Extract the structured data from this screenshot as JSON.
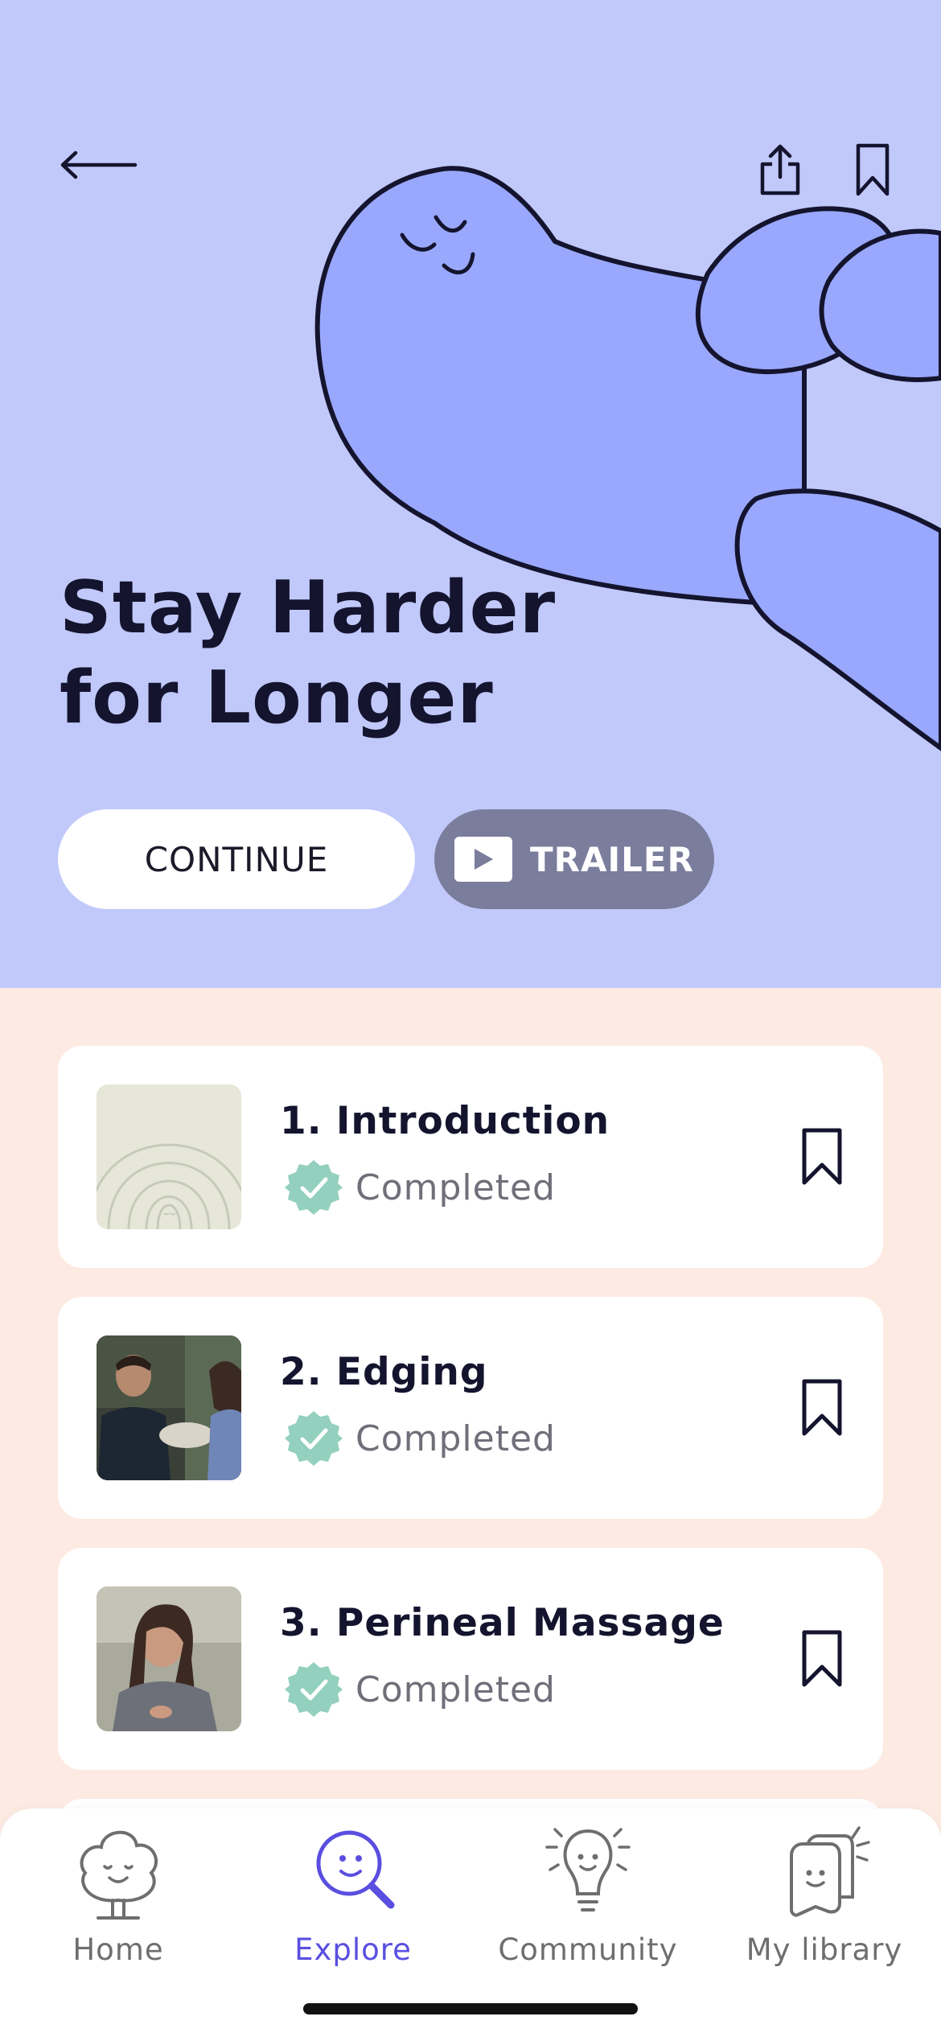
{
  "hero": {
    "title_line1": "Stay Harder",
    "title_line2": "for Longer",
    "background_color": "#c1c9fb",
    "continue_label": "CONTINUE",
    "trailer_label": "TRAILER",
    "icons": [
      "back-arrow-icon",
      "share-icon",
      "bookmark-icon",
      "play-icon"
    ]
  },
  "lessons": [
    {
      "title": "1. Introduction",
      "status": "Completed",
      "thumbnail": "rainbow-illustration"
    },
    {
      "title": "2. Edging",
      "status": "Completed",
      "thumbnail": "video-still-two-people"
    },
    {
      "title": "3. Perineal Massage",
      "status": "Completed",
      "thumbnail": "video-still-woman"
    }
  ],
  "status_badge_color": "#93d0be",
  "tabbar": {
    "items": [
      {
        "label": "Home",
        "icon": "tree-icon",
        "active": false
      },
      {
        "label": "Explore",
        "icon": "magnifier-face-icon",
        "active": true
      },
      {
        "label": "Community",
        "icon": "lightbulb-icon",
        "active": false
      },
      {
        "label": "My library",
        "icon": "library-cards-icon",
        "active": false
      }
    ],
    "active_color": "#5a4fe0"
  }
}
